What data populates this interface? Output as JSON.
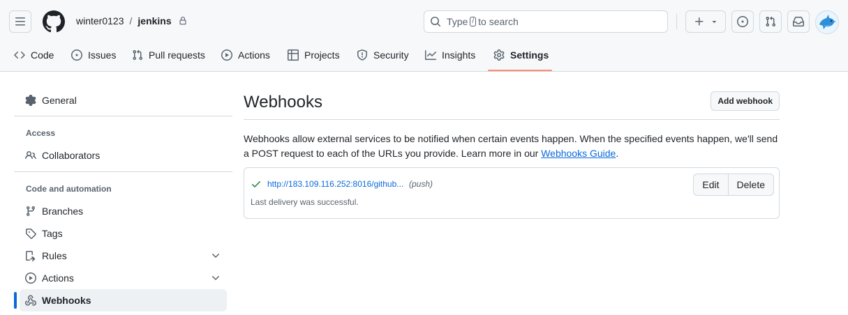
{
  "header": {
    "owner": "winter0123",
    "separator": "/",
    "repo": "jenkins",
    "search_prefix": "Type",
    "search_key": "/",
    "search_suffix": "to search",
    "colors": {
      "bg": "#f6f8fa",
      "border": "#d1d9e0",
      "tab_underline": "#fd8c73"
    }
  },
  "repo_nav": {
    "tabs": [
      {
        "label": "Code",
        "icon": "code-icon"
      },
      {
        "label": "Issues",
        "icon": "issue-opened-icon"
      },
      {
        "label": "Pull requests",
        "icon": "git-pull-request-icon"
      },
      {
        "label": "Actions",
        "icon": "play-icon"
      },
      {
        "label": "Projects",
        "icon": "table-icon"
      },
      {
        "label": "Security",
        "icon": "shield-icon"
      },
      {
        "label": "Insights",
        "icon": "graph-icon"
      },
      {
        "label": "Settings",
        "icon": "gear-icon",
        "selected": true
      }
    ]
  },
  "sidebar": {
    "general": "General",
    "access_heading": "Access",
    "collaborators": "Collaborators",
    "code_heading": "Code and automation",
    "items": [
      {
        "label": "Branches",
        "icon": "git-branch-icon"
      },
      {
        "label": "Tags",
        "icon": "tag-icon"
      },
      {
        "label": "Rules",
        "icon": "rules-icon",
        "expandable": true
      },
      {
        "label": "Actions",
        "icon": "play-icon",
        "expandable": true
      },
      {
        "label": "Webhooks",
        "icon": "webhook-icon",
        "active": true
      }
    ],
    "accent": "#0969da"
  },
  "main": {
    "title": "Webhooks",
    "add_button": "Add webhook",
    "description": "Webhooks allow external services to be notified when certain events happen. When the specified events happen, we'll send a POST request to each of the URLs you provide. Learn more in our ",
    "guide_link": "Webhooks Guide",
    "description_end": ".",
    "hook": {
      "url": "http://183.109.116.252:8016/github...",
      "events": "(push)",
      "status": "Last delivery was successful.",
      "status_color": "#1a7f37",
      "edit": "Edit",
      "delete": "Delete"
    }
  }
}
